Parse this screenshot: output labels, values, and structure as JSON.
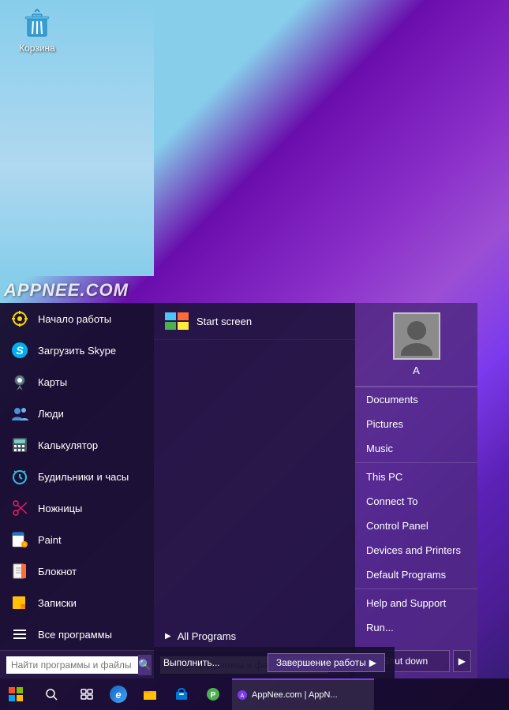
{
  "desktop": {
    "recycle_bin_label": "Корзина",
    "watermark": "APPNEE.COM"
  },
  "start_menu": {
    "programs": [
      {
        "id": "startup",
        "label": "Начало работы",
        "icon": "☀"
      },
      {
        "id": "skype",
        "label": "Загрузить Skype",
        "icon": "S"
      },
      {
        "id": "maps",
        "label": "Карты",
        "icon": "👤"
      },
      {
        "id": "people",
        "label": "Люди",
        "icon": "👥"
      },
      {
        "id": "calc",
        "label": "Калькулятор",
        "icon": "▦"
      },
      {
        "id": "alarms",
        "label": "Будильники и часы",
        "icon": "⊙"
      },
      {
        "id": "scissors",
        "label": "Ножницы",
        "icon": "✂"
      },
      {
        "id": "paint",
        "label": "Paint",
        "icon": "🎨"
      },
      {
        "id": "notepad",
        "label": "Блокнот",
        "icon": "📄"
      },
      {
        "id": "stickynotes",
        "label": "Записки",
        "icon": "📁"
      },
      {
        "id": "allprograms",
        "label": "Все программы",
        "icon": "≡"
      }
    ],
    "search_placeholder": "Найти программы и файлы",
    "start_screen_label": "Start screen",
    "all_programs_label": "All Programs",
    "right_panel": {
      "user_name": "A",
      "menu_items": [
        {
          "id": "documents",
          "label": "Documents"
        },
        {
          "id": "pictures",
          "label": "Pictures"
        },
        {
          "id": "music",
          "label": "Music"
        },
        {
          "id": "thispc",
          "label": "This PC"
        },
        {
          "id": "connectto",
          "label": "Connect To"
        },
        {
          "id": "controlpanel",
          "label": "Control Panel"
        },
        {
          "id": "devicesandprinters",
          "label": "Devices and Printers"
        },
        {
          "id": "defaultprograms",
          "label": "Default Programs"
        },
        {
          "id": "helpandsupport",
          "label": "Help and Support"
        },
        {
          "id": "run",
          "label": "Run..."
        }
      ],
      "shutdown_label": "Shut down",
      "shutdown_arrow": "▶"
    }
  },
  "notification": {
    "text": "Выполнить...",
    "button_label": "Завершение работы",
    "button_arrow": "▶"
  },
  "taskbar": {
    "start_icon": "⊞",
    "search_icon": "🔍",
    "apps": [
      {
        "id": "appnee",
        "label": "AppNee.com | AppN..."
      }
    ]
  }
}
